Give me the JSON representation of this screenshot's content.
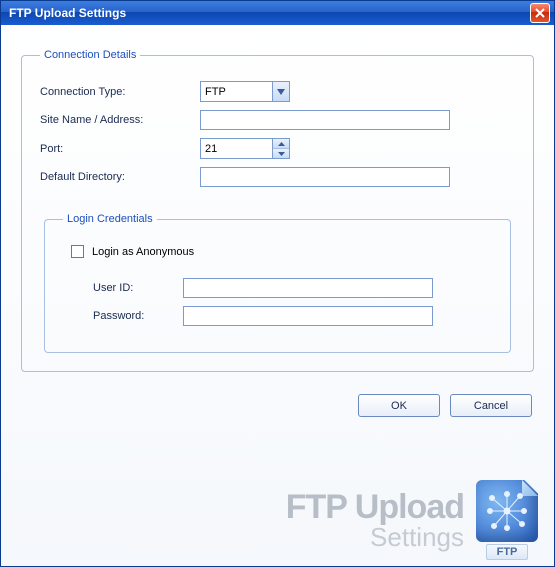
{
  "window": {
    "title": "FTP Upload Settings"
  },
  "groups": {
    "connection_legend": "Connection Details",
    "login_legend": "Login Credentials"
  },
  "fields": {
    "connection_type": {
      "label": "Connection Type:",
      "value": "FTP"
    },
    "site": {
      "label": "Site Name / Address:",
      "value": ""
    },
    "port": {
      "label": "Port:",
      "value": "21"
    },
    "default_dir": {
      "label": "Default Directory:",
      "value": ""
    },
    "anon": {
      "label": "Login as Anonymous",
      "checked": false
    },
    "user": {
      "label": "User ID:",
      "value": ""
    },
    "password": {
      "label": "Password:",
      "value": ""
    }
  },
  "buttons": {
    "ok": "OK",
    "cancel": "Cancel"
  },
  "footer": {
    "line1": "FTP Upload",
    "line2": "Settings",
    "badge": "FTP"
  }
}
